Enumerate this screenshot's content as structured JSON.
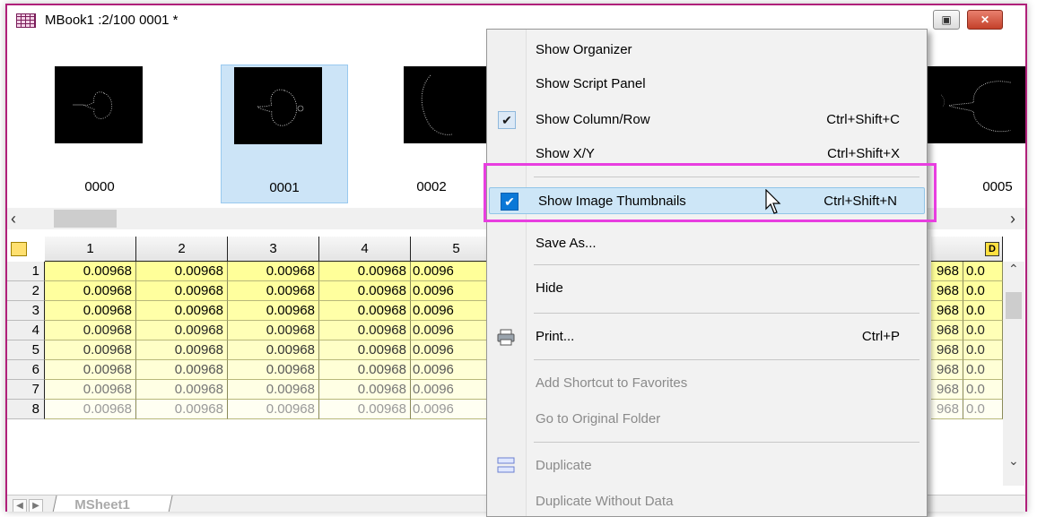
{
  "window": {
    "title": "MBook1 :2/100 0001 *",
    "buttons": {
      "restore": "▣",
      "close": "✕"
    }
  },
  "thumbnails": [
    {
      "label": "0000",
      "selected": false
    },
    {
      "label": "0001",
      "selected": true
    },
    {
      "label": "0002",
      "selected": false
    },
    {
      "label": "0005",
      "selected": false
    }
  ],
  "grid": {
    "columns": [
      "1",
      "2",
      "3",
      "4",
      "5"
    ],
    "row_numbers": [
      "1",
      "2",
      "3",
      "4",
      "5",
      "6",
      "7",
      "8"
    ],
    "cell_value": "0.00968",
    "partial_value": "0.0096",
    "right_partial_a": "968",
    "right_partial_b": "0.0",
    "badge": "D"
  },
  "sheet_tab": "MSheet1",
  "menu": {
    "items": [
      {
        "label": "Show Organizer",
        "shortcut": "",
        "checked": false,
        "disabled": false
      },
      {
        "label": "Show Script Panel",
        "shortcut": "",
        "checked": false,
        "disabled": false
      },
      {
        "label": "Show Column/Row",
        "shortcut": "Ctrl+Shift+C",
        "checked": true,
        "disabled": false
      },
      {
        "label": "Show X/Y",
        "shortcut": "Ctrl+Shift+X",
        "checked": false,
        "disabled": false
      },
      {
        "label": "Show Image Thumbnails",
        "shortcut": "Ctrl+Shift+N",
        "checked": true,
        "disabled": false,
        "highlighted": true
      },
      {
        "label": "Save As...",
        "shortcut": "",
        "checked": false,
        "disabled": false
      },
      {
        "label": "Hide",
        "shortcut": "",
        "checked": false,
        "disabled": false
      },
      {
        "label": "Print...",
        "shortcut": "Ctrl+P",
        "checked": false,
        "disabled": false,
        "icon": "printer-icon"
      },
      {
        "label": "Add Shortcut to Favorites",
        "shortcut": "",
        "checked": false,
        "disabled": true
      },
      {
        "label": "Go to Original Folder",
        "shortcut": "",
        "checked": false,
        "disabled": true
      },
      {
        "label": "Duplicate",
        "shortcut": "",
        "checked": false,
        "disabled": true,
        "icon": "duplicate-icon"
      },
      {
        "label": "Duplicate Without Data",
        "shortcut": "",
        "checked": false,
        "disabled": true
      }
    ]
  },
  "colors": {
    "accent_border": "#b0207a",
    "highlight_box": "#e83ee0",
    "selection_blue": "#0a78d7",
    "cell_yellow": "#ffff99"
  }
}
